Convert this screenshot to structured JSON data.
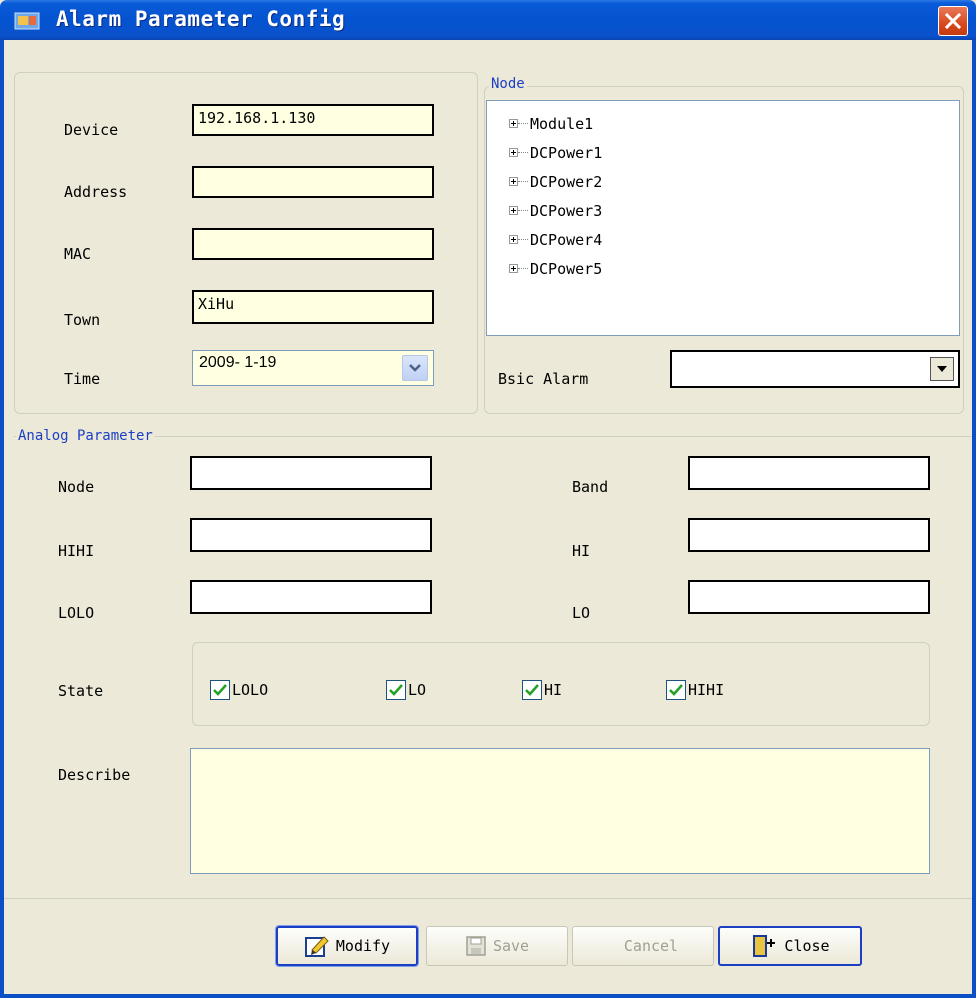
{
  "window": {
    "title": "Alarm Parameter Config"
  },
  "device_panel": {
    "device_label": "Device",
    "device_value": "192.168.1.130",
    "address_label": "Address",
    "address_value": "",
    "mac_label": "MAC",
    "mac_value": "",
    "town_label": "Town",
    "town_value": "XiHu",
    "time_label": "Time",
    "time_value": "2009- 1-19"
  },
  "node_panel": {
    "legend": "Node",
    "tree_items": [
      "Module1",
      "DCPower1",
      "DCPower2",
      "DCPower3",
      "DCPower4",
      "DCPower5"
    ],
    "basic_alarm_label": "Bsic Alarm",
    "basic_alarm_value": ""
  },
  "analog_panel": {
    "legend": "Analog Parameter",
    "node_label": "Node",
    "band_label": "Band",
    "hihi_label": "HIHI",
    "hi_label": "HI",
    "lolo_label": "LOLO",
    "lo_label": "LO",
    "state_label": "State",
    "states": [
      {
        "label": "LOLO",
        "checked": true
      },
      {
        "label": "LO",
        "checked": true
      },
      {
        "label": "HI",
        "checked": true
      },
      {
        "label": "HIHI",
        "checked": true
      }
    ],
    "describe_label": "Describe",
    "describe_value": ""
  },
  "buttons": {
    "modify": "Modify",
    "save": "Save",
    "cancel": "Cancel",
    "close": "Close"
  },
  "colors": {
    "titlebar": "#0453d0",
    "field_bg": "#ffffe1",
    "legend": "#1c3fc4",
    "check": "#21a121"
  },
  "icons": [
    "alarm-app-icon",
    "close-icon",
    "calendar-dropdown-icon",
    "tree-expand-icon",
    "dropdown-arrow-icon",
    "checkmark-icon",
    "modify-icon",
    "save-icon",
    "exit-door-icon"
  ]
}
